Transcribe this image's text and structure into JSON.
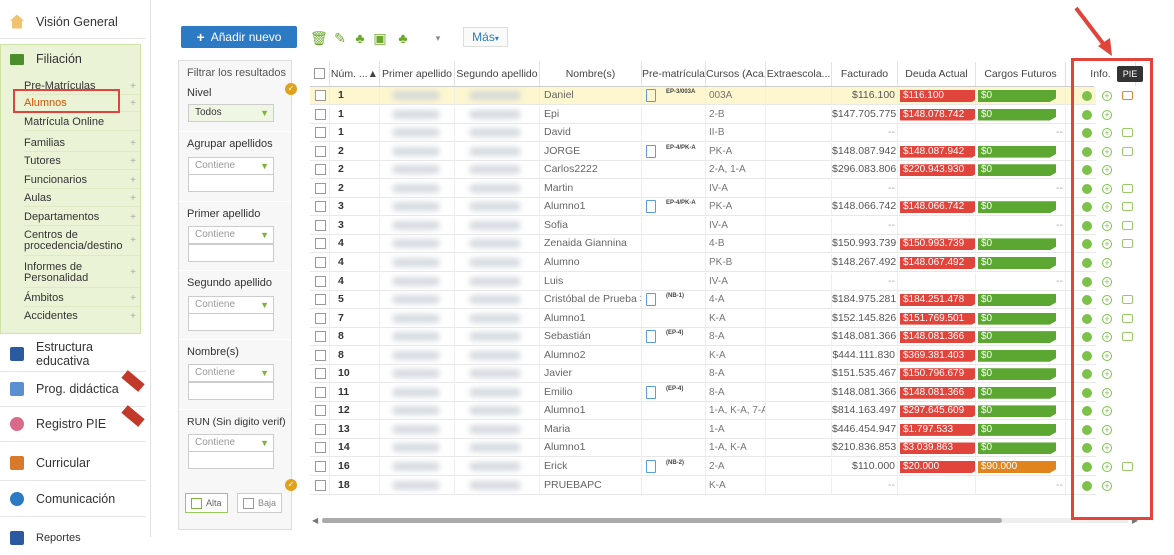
{
  "nav": {
    "vision_general": "Visión General",
    "filiacion": "Filiación",
    "sub_items": [
      "Pre-Matrículas",
      "Alumnos",
      "Matrícula Online",
      "Familias",
      "Tutores",
      "Funcionarios",
      "Aulas",
      "Departamentos",
      "Centros de procedencia/destino",
      "Informes de Personalidad",
      "Ámbitos",
      "Accidentes"
    ],
    "estructura": "Estructura educativa",
    "prog": "Prog. didáctica",
    "registro_pie": "Registro PIE",
    "curricular": "Curricular",
    "comunicacion": "Comunicación",
    "reportes": "Reportes"
  },
  "toolbar": {
    "add_label": "Añadir nuevo",
    "more_label": "Más"
  },
  "filters": {
    "title": "Filtrar los resultados",
    "nivel_label": "Nivel",
    "nivel_value": "Todos",
    "agrupar_label": "Agrupar apellidos",
    "primer_label": "Primer apellido",
    "segundo_label": "Segundo apellido",
    "nombre_label": "Nombre(s)",
    "run_label": "RUN (Sin digito verif)",
    "contains": "Contiene",
    "alta": "Alta",
    "baja": "Baja"
  },
  "table": {
    "headers": [
      "Núm. ...▲",
      "Primer apellido",
      "Segundo apellido",
      "Nombre(s)",
      "Pre-matrícula",
      "Cursos (Aca...",
      "Extraescola...",
      "Facturado",
      "Deuda Actual",
      "Cargos Futuros",
      "Info."
    ],
    "rows": [
      {
        "num": "1",
        "nombre": "Daniel",
        "pre": "EP-3/003A",
        "curso": "003A",
        "fact": "$116.100",
        "deuda": "$116.100",
        "cargo": "$0",
        "note": true
      },
      {
        "num": "1",
        "nombre": "Epi",
        "pre": "",
        "curso": "2-B",
        "fact": "$147.705.775",
        "deuda": "$148.078.742",
        "cargo": "$0",
        "note": false
      },
      {
        "num": "1",
        "nombre": "David",
        "pre": "",
        "curso": "II-B",
        "fact": "--",
        "deuda": "",
        "cargo": "--",
        "note": true
      },
      {
        "num": "2",
        "nombre": "JORGE",
        "pre": "EP-4/PK-A",
        "curso": "PK-A",
        "fact": "$148.087.942",
        "deuda": "$148.087.942",
        "cargo": "$0",
        "note": true
      },
      {
        "num": "2",
        "nombre": "Carlos2222",
        "pre": "",
        "curso": "2-A, 1-A",
        "fact": "$296.083.806",
        "deuda": "$220.943.930",
        "cargo": "$0",
        "note": false
      },
      {
        "num": "2",
        "nombre": "Martin",
        "pre": "",
        "curso": "IV-A",
        "fact": "--",
        "deuda": "",
        "cargo": "--",
        "note": true
      },
      {
        "num": "3",
        "nombre": "Alumno1",
        "pre": "EP-4/PK-A",
        "curso": "PK-A",
        "fact": "$148.066.742",
        "deuda": "$148.066.742",
        "cargo": "$0",
        "note": true
      },
      {
        "num": "3",
        "nombre": "Sofia",
        "pre": "",
        "curso": "IV-A",
        "fact": "--",
        "deuda": "",
        "cargo": "--",
        "note": true
      },
      {
        "num": "4",
        "nombre": "Zenaida Giannina",
        "pre": "",
        "curso": "4-B",
        "fact": "$150.993.739",
        "deuda": "$150.993.739",
        "cargo": "$0",
        "note": true
      },
      {
        "num": "4",
        "nombre": "Alumno",
        "pre": "",
        "curso": "PK-B",
        "fact": "$148.267.492",
        "deuda": "$148.067.492",
        "cargo": "$0",
        "note": false
      },
      {
        "num": "4",
        "nombre": "Luis",
        "pre": "",
        "curso": "IV-A",
        "fact": "--",
        "deuda": "",
        "cargo": "--",
        "note": false
      },
      {
        "num": "5",
        "nombre": "Cristóbal de Prueba 35",
        "pre": "(NB-1)",
        "curso": "4-A",
        "fact": "$184.975.281",
        "deuda": "$184.251.478",
        "cargo": "$0",
        "note": true
      },
      {
        "num": "7",
        "nombre": "Alumno1",
        "pre": "",
        "curso": "K-A",
        "fact": "$152.145.826",
        "deuda": "$151.769.501",
        "cargo": "$0",
        "note": true
      },
      {
        "num": "8",
        "nombre": "Sebastián",
        "pre": "(EP-4)",
        "curso": "8-A",
        "fact": "$148.081.366",
        "deuda": "$148.081.366",
        "cargo": "$0",
        "note": true
      },
      {
        "num": "8",
        "nombre": "Alumno2",
        "pre": "",
        "curso": "K-A",
        "fact": "$444.111.830",
        "deuda": "$369.381.403",
        "cargo": "$0",
        "note": false
      },
      {
        "num": "10",
        "nombre": "Javier",
        "pre": "",
        "curso": "8-A",
        "fact": "$151.535.467",
        "deuda": "$150.796.679",
        "cargo": "$0",
        "note": false
      },
      {
        "num": "11",
        "nombre": "Emilio",
        "pre": "(EP-4)",
        "curso": "8-A",
        "fact": "$148.081.366",
        "deuda": "$148.081.366",
        "cargo": "$0",
        "note": false
      },
      {
        "num": "12",
        "nombre": "Alumno1",
        "pre": "",
        "curso": "1-A, K-A, 7-A",
        "fact": "$814.163.497",
        "deuda": "$297.645.609",
        "cargo": "$0",
        "note": false
      },
      {
        "num": "13",
        "nombre": "Maria",
        "pre": "",
        "curso": "1-A",
        "fact": "$446.454.947",
        "deuda": "$1.797.533",
        "cargo": "$0",
        "note": false
      },
      {
        "num": "14",
        "nombre": "Alumno1",
        "pre": "",
        "curso": "1-A, K-A",
        "fact": "$210.836.853",
        "deuda": "$3.039.863",
        "cargo": "$0",
        "note": false
      },
      {
        "num": "16",
        "nombre": "Erick",
        "pre": "(NB-2)",
        "curso": "2-A",
        "fact": "$110.000",
        "deuda": "$20.000",
        "cargo": "$90.000",
        "note": true
      },
      {
        "num": "18",
        "nombre": "PRUEBAPC",
        "pre": "",
        "curso": "K-A",
        "fact": "--",
        "deuda": "",
        "cargo": "--",
        "note": false
      }
    ]
  },
  "tooltip": "PIE",
  "colors": {
    "accent": "#2c79c4",
    "debt": "#e0443a",
    "ok": "#5ca632",
    "future": "#e0841d",
    "highlight": "#e0443a"
  }
}
